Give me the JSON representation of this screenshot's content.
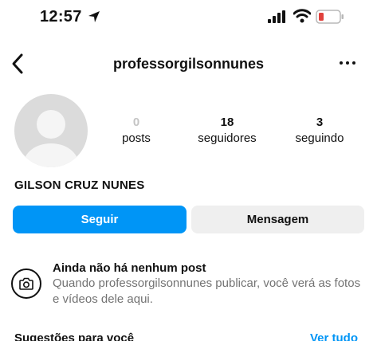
{
  "status_bar": {
    "time": "12:57",
    "icons": [
      "location-arrow-icon",
      "cellular-signal-icon",
      "wifi-icon",
      "battery-low-icon"
    ],
    "battery_color": "#e0413c"
  },
  "header": {
    "username": "professorgilsonnunes",
    "back_icon": "chevron-left-icon",
    "more_icon": "ellipsis-icon"
  },
  "profile": {
    "avatar_icon": "default-avatar-icon",
    "full_name": "GILSON CRUZ NUNES",
    "stats": [
      {
        "value": "0",
        "label": "posts"
      },
      {
        "value": "18",
        "label": "seguidores"
      },
      {
        "value": "3",
        "label": "seguindo"
      }
    ]
  },
  "actions": {
    "follow_label": "Seguir",
    "message_label": "Mensagem",
    "accent": "#0095f6"
  },
  "empty_state": {
    "icon": "camera-icon",
    "title": "Ainda não há nenhum post",
    "description": "Quando professorgilsonnunes publicar, você verá as fotos e vídeos dele aqui."
  },
  "suggestions": {
    "title": "Sugestões para você",
    "see_all": "Ver tudo"
  }
}
